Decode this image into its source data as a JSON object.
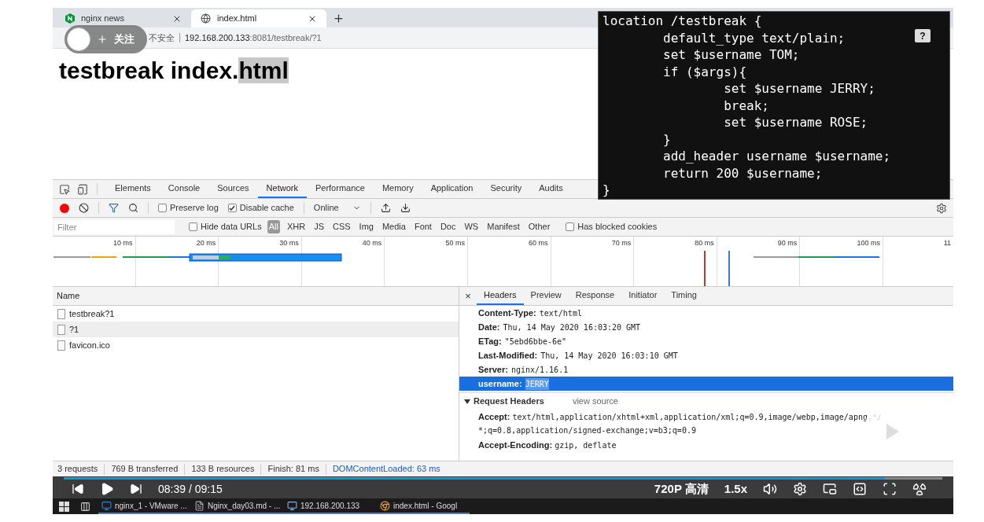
{
  "browser": {
    "tabs": [
      {
        "title": "nginx news",
        "selected": false,
        "kind": "nginx"
      },
      {
        "title": "index.html",
        "selected": true,
        "kind": "globe"
      }
    ],
    "address": {
      "security": "不安全",
      "host": "192.168.200.133",
      "path": ":8081/testbreak/?1"
    },
    "follow_badge": {
      "label": "关注"
    },
    "page": {
      "heading": "testbreak index.",
      "heading_selected": "html"
    }
  },
  "devtools": {
    "tabs": [
      {
        "label": "Elements",
        "selected": false
      },
      {
        "label": "Console",
        "selected": false
      },
      {
        "label": "Sources",
        "selected": false
      },
      {
        "label": "Network",
        "selected": true
      },
      {
        "label": "Performance",
        "selected": false
      },
      {
        "label": "Memory",
        "selected": false
      },
      {
        "label": "Application",
        "selected": false
      },
      {
        "label": "Security",
        "selected": false
      },
      {
        "label": "Audits",
        "selected": false
      }
    ],
    "toolbar": {
      "recording": true,
      "filter_active": true,
      "preserve_log": {
        "label": "Preserve log",
        "checked": false
      },
      "disable_cache": {
        "label": "Disable cache",
        "checked": true
      },
      "throttling": "Online"
    },
    "filter": {
      "placeholder": "Filter",
      "hide_data_urls": {
        "label": "Hide data URLs",
        "checked": false
      },
      "types": [
        {
          "label": "All",
          "selected": true
        },
        {
          "label": "XHR",
          "selected": false
        },
        {
          "label": "JS",
          "selected": false
        },
        {
          "label": "CSS",
          "selected": false
        },
        {
          "label": "Img",
          "selected": false
        },
        {
          "label": "Media",
          "selected": false
        },
        {
          "label": "Font",
          "selected": false
        },
        {
          "label": "Doc",
          "selected": false
        },
        {
          "label": "WS",
          "selected": false
        },
        {
          "label": "Manifest",
          "selected": false
        },
        {
          "label": "Other",
          "selected": false
        }
      ],
      "blocked_cookies": {
        "label": "Has blocked cookies",
        "checked": false
      }
    },
    "timeline": {
      "ticks": [
        "10 ms",
        "20 ms",
        "30 ms",
        "40 ms",
        "50 ms",
        "60 ms",
        "70 ms",
        "80 ms",
        "90 ms",
        "100 ms",
        "11"
      ]
    },
    "requests": {
      "column": "Name",
      "rows": [
        {
          "name": "testbreak?1",
          "selected": false
        },
        {
          "name": "?1",
          "selected": true
        },
        {
          "name": "favicon.ico",
          "selected": false
        }
      ]
    },
    "details": {
      "close": "×",
      "tabs": [
        {
          "label": "Headers",
          "selected": true
        },
        {
          "label": "Preview",
          "selected": false
        },
        {
          "label": "Response",
          "selected": false
        },
        {
          "label": "Initiator",
          "selected": false
        },
        {
          "label": "Timing",
          "selected": false
        }
      ],
      "response_headers": [
        {
          "name": "Content-Type:",
          "value": "text/html",
          "selected": false
        },
        {
          "name": "Date:",
          "value": "Thu, 14 May 2020 16:03:20 GMT",
          "selected": false
        },
        {
          "name": "ETag:",
          "value": "\"5ebd6bbe-6e\"",
          "selected": false
        },
        {
          "name": "Last-Modified:",
          "value": "Thu, 14 May 2020 16:03:10 GMT",
          "selected": false
        },
        {
          "name": "Server:",
          "value": "nginx/1.16.1",
          "selected": false
        },
        {
          "name": "username:",
          "value": "JERRY",
          "selected": true
        }
      ],
      "request_section": {
        "title": "Request Headers",
        "link": "view source",
        "expanded": true
      },
      "request_headers": [
        {
          "name": "Accept:",
          "value": "text/html,application/xhtml+xml,application/xml;q=0.9,image/webp,image/apng,*/*;q=0.8,application/signed-exchange;v=b3;q=0.9"
        },
        {
          "name": "Accept-Encoding:",
          "value": "gzip, deflate"
        }
      ]
    },
    "status_bar": [
      {
        "text": "3 requests",
        "kind": "metric"
      },
      {
        "text": "769 B transferred",
        "kind": "metric"
      },
      {
        "text": "133 B resources",
        "kind": "metric"
      },
      {
        "text": "Finish: 81 ms",
        "kind": "metric"
      },
      {
        "text": "DOMContentLoaded: 63 ms",
        "kind": "event"
      }
    ]
  },
  "code_overlay": {
    "lines": [
      "location /testbreak {",
      "        default_type text/plain;",
      "        set $username TOM;",
      "        if ($args){",
      "                set $username JERRY;",
      "                break;",
      "                set $username ROSE;",
      "        }",
      "        add_header username $username;",
      "        return 200 $username;",
      "}"
    ],
    "badge": "?"
  },
  "player": {
    "time": "08:39 / 09:15",
    "level": 0.935,
    "quality": "720P 高清",
    "speed": "1.5x"
  },
  "taskbar": {
    "items": [
      {
        "label": "nginx_1 - VMware ...",
        "kind": "vm"
      },
      {
        "label": "Nginx_day03.md - ...",
        "kind": "doc"
      },
      {
        "label": "192.168.200.133",
        "kind": "remote"
      },
      {
        "label": "index.html - Googl",
        "kind": "chrome"
      }
    ]
  }
}
